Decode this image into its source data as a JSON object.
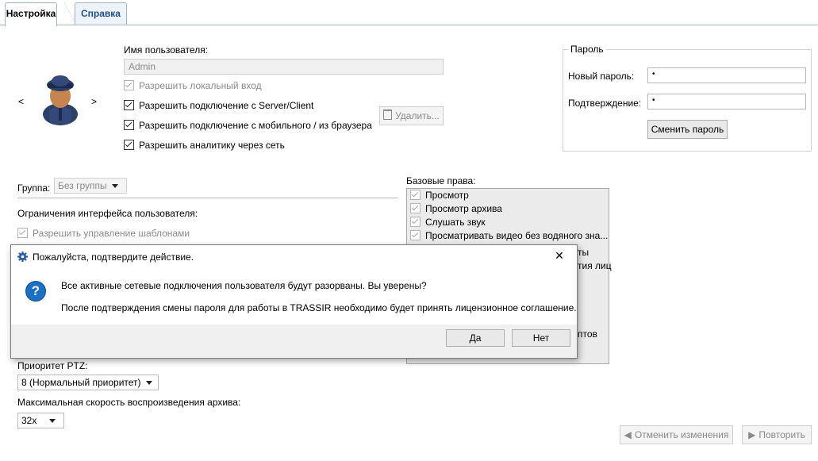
{
  "tabs": [
    {
      "label": "Настройка",
      "active": true
    },
    {
      "label": "Справка",
      "active": false
    }
  ],
  "user": {
    "nav_prev": "<",
    "nav_next": ">",
    "username_label": "Имя пользователя:",
    "username_value": "Admin",
    "checkboxes": [
      {
        "label": "Разрешить локальный вход",
        "checked": true,
        "enabled": false
      },
      {
        "label": "Разрешить подключение с Server/Client",
        "checked": true,
        "enabled": true
      },
      {
        "label": "Разрешить подключение с мобильного / из браузера",
        "checked": true,
        "enabled": true
      },
      {
        "label": "Разрешить аналитику через сеть",
        "checked": true,
        "enabled": true
      }
    ],
    "delete_label": "Удалить..."
  },
  "password": {
    "group_title": "Пароль",
    "new_label": "Новый пароль:",
    "new_value": "•",
    "confirm_label": "Подтверждение:",
    "confirm_value": "•",
    "change_button": "Сменить пароль"
  },
  "group": {
    "label": "Группа:",
    "value": "Без группы"
  },
  "restrictions": {
    "title": "Ограничения интерфейса пользователя:",
    "templates_label": "Разрешить управление шаблонами"
  },
  "rights": {
    "title": "Базовые права:",
    "items": [
      "Просмотр",
      "Просмотр архива",
      "Слушать звук",
      "Просматривать видео без водяного зна..."
    ],
    "partial_right": [
      "ты",
      "тия лиц",
      "птов"
    ]
  },
  "ptz": {
    "label": "Приоритет PTZ:",
    "value": "8 (Нормальный приоритет)"
  },
  "speed": {
    "label": "Максимальная скорость воспроизведения архива:",
    "value": "32x"
  },
  "footer": {
    "undo_label": "Отменить изменения",
    "redo_label": "Повторить"
  },
  "dialog": {
    "title": "Пожалуйста, подтвердите действие.",
    "close": "✕",
    "message1": "Все активные сетевые подключения пользователя будут разорваны. Вы уверены?",
    "message2": "После подтверждения смены пароля для работы в TRASSIR необходимо будет принять лицензионное соглашение.",
    "yes_label": "Да",
    "no_label": "Нет",
    "icon_glyph": "?"
  },
  "colors": {
    "accent": "#1c6fc6",
    "tab_border": "#9db3cf"
  }
}
